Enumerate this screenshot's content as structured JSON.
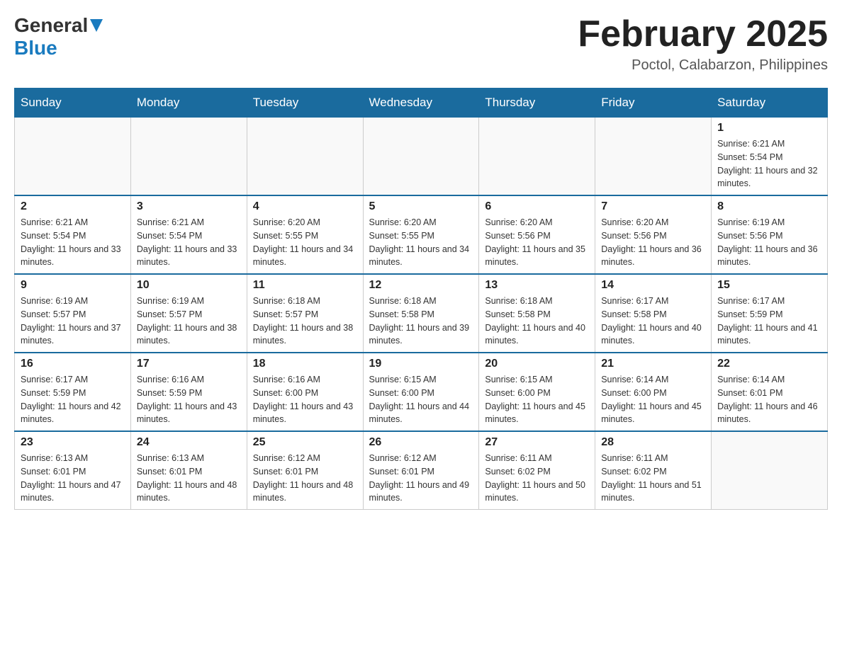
{
  "header": {
    "logo_general": "General",
    "logo_blue": "Blue",
    "month_title": "February 2025",
    "location": "Poctol, Calabarzon, Philippines"
  },
  "days_of_week": [
    "Sunday",
    "Monday",
    "Tuesday",
    "Wednesday",
    "Thursday",
    "Friday",
    "Saturday"
  ],
  "weeks": [
    {
      "days": [
        {
          "number": "",
          "sunrise": "",
          "sunset": "",
          "daylight": "",
          "empty": true
        },
        {
          "number": "",
          "sunrise": "",
          "sunset": "",
          "daylight": "",
          "empty": true
        },
        {
          "number": "",
          "sunrise": "",
          "sunset": "",
          "daylight": "",
          "empty": true
        },
        {
          "number": "",
          "sunrise": "",
          "sunset": "",
          "daylight": "",
          "empty": true
        },
        {
          "number": "",
          "sunrise": "",
          "sunset": "",
          "daylight": "",
          "empty": true
        },
        {
          "number": "",
          "sunrise": "",
          "sunset": "",
          "daylight": "",
          "empty": true
        },
        {
          "number": "1",
          "sunrise": "Sunrise: 6:21 AM",
          "sunset": "Sunset: 5:54 PM",
          "daylight": "Daylight: 11 hours and 32 minutes.",
          "empty": false
        }
      ]
    },
    {
      "days": [
        {
          "number": "2",
          "sunrise": "Sunrise: 6:21 AM",
          "sunset": "Sunset: 5:54 PM",
          "daylight": "Daylight: 11 hours and 33 minutes.",
          "empty": false
        },
        {
          "number": "3",
          "sunrise": "Sunrise: 6:21 AM",
          "sunset": "Sunset: 5:54 PM",
          "daylight": "Daylight: 11 hours and 33 minutes.",
          "empty": false
        },
        {
          "number": "4",
          "sunrise": "Sunrise: 6:20 AM",
          "sunset": "Sunset: 5:55 PM",
          "daylight": "Daylight: 11 hours and 34 minutes.",
          "empty": false
        },
        {
          "number": "5",
          "sunrise": "Sunrise: 6:20 AM",
          "sunset": "Sunset: 5:55 PM",
          "daylight": "Daylight: 11 hours and 34 minutes.",
          "empty": false
        },
        {
          "number": "6",
          "sunrise": "Sunrise: 6:20 AM",
          "sunset": "Sunset: 5:56 PM",
          "daylight": "Daylight: 11 hours and 35 minutes.",
          "empty": false
        },
        {
          "number": "7",
          "sunrise": "Sunrise: 6:20 AM",
          "sunset": "Sunset: 5:56 PM",
          "daylight": "Daylight: 11 hours and 36 minutes.",
          "empty": false
        },
        {
          "number": "8",
          "sunrise": "Sunrise: 6:19 AM",
          "sunset": "Sunset: 5:56 PM",
          "daylight": "Daylight: 11 hours and 36 minutes.",
          "empty": false
        }
      ]
    },
    {
      "days": [
        {
          "number": "9",
          "sunrise": "Sunrise: 6:19 AM",
          "sunset": "Sunset: 5:57 PM",
          "daylight": "Daylight: 11 hours and 37 minutes.",
          "empty": false
        },
        {
          "number": "10",
          "sunrise": "Sunrise: 6:19 AM",
          "sunset": "Sunset: 5:57 PM",
          "daylight": "Daylight: 11 hours and 38 minutes.",
          "empty": false
        },
        {
          "number": "11",
          "sunrise": "Sunrise: 6:18 AM",
          "sunset": "Sunset: 5:57 PM",
          "daylight": "Daylight: 11 hours and 38 minutes.",
          "empty": false
        },
        {
          "number": "12",
          "sunrise": "Sunrise: 6:18 AM",
          "sunset": "Sunset: 5:58 PM",
          "daylight": "Daylight: 11 hours and 39 minutes.",
          "empty": false
        },
        {
          "number": "13",
          "sunrise": "Sunrise: 6:18 AM",
          "sunset": "Sunset: 5:58 PM",
          "daylight": "Daylight: 11 hours and 40 minutes.",
          "empty": false
        },
        {
          "number": "14",
          "sunrise": "Sunrise: 6:17 AM",
          "sunset": "Sunset: 5:58 PM",
          "daylight": "Daylight: 11 hours and 40 minutes.",
          "empty": false
        },
        {
          "number": "15",
          "sunrise": "Sunrise: 6:17 AM",
          "sunset": "Sunset: 5:59 PM",
          "daylight": "Daylight: 11 hours and 41 minutes.",
          "empty": false
        }
      ]
    },
    {
      "days": [
        {
          "number": "16",
          "sunrise": "Sunrise: 6:17 AM",
          "sunset": "Sunset: 5:59 PM",
          "daylight": "Daylight: 11 hours and 42 minutes.",
          "empty": false
        },
        {
          "number": "17",
          "sunrise": "Sunrise: 6:16 AM",
          "sunset": "Sunset: 5:59 PM",
          "daylight": "Daylight: 11 hours and 43 minutes.",
          "empty": false
        },
        {
          "number": "18",
          "sunrise": "Sunrise: 6:16 AM",
          "sunset": "Sunset: 6:00 PM",
          "daylight": "Daylight: 11 hours and 43 minutes.",
          "empty": false
        },
        {
          "number": "19",
          "sunrise": "Sunrise: 6:15 AM",
          "sunset": "Sunset: 6:00 PM",
          "daylight": "Daylight: 11 hours and 44 minutes.",
          "empty": false
        },
        {
          "number": "20",
          "sunrise": "Sunrise: 6:15 AM",
          "sunset": "Sunset: 6:00 PM",
          "daylight": "Daylight: 11 hours and 45 minutes.",
          "empty": false
        },
        {
          "number": "21",
          "sunrise": "Sunrise: 6:14 AM",
          "sunset": "Sunset: 6:00 PM",
          "daylight": "Daylight: 11 hours and 45 minutes.",
          "empty": false
        },
        {
          "number": "22",
          "sunrise": "Sunrise: 6:14 AM",
          "sunset": "Sunset: 6:01 PM",
          "daylight": "Daylight: 11 hours and 46 minutes.",
          "empty": false
        }
      ]
    },
    {
      "days": [
        {
          "number": "23",
          "sunrise": "Sunrise: 6:13 AM",
          "sunset": "Sunset: 6:01 PM",
          "daylight": "Daylight: 11 hours and 47 minutes.",
          "empty": false
        },
        {
          "number": "24",
          "sunrise": "Sunrise: 6:13 AM",
          "sunset": "Sunset: 6:01 PM",
          "daylight": "Daylight: 11 hours and 48 minutes.",
          "empty": false
        },
        {
          "number": "25",
          "sunrise": "Sunrise: 6:12 AM",
          "sunset": "Sunset: 6:01 PM",
          "daylight": "Daylight: 11 hours and 48 minutes.",
          "empty": false
        },
        {
          "number": "26",
          "sunrise": "Sunrise: 6:12 AM",
          "sunset": "Sunset: 6:01 PM",
          "daylight": "Daylight: 11 hours and 49 minutes.",
          "empty": false
        },
        {
          "number": "27",
          "sunrise": "Sunrise: 6:11 AM",
          "sunset": "Sunset: 6:02 PM",
          "daylight": "Daylight: 11 hours and 50 minutes.",
          "empty": false
        },
        {
          "number": "28",
          "sunrise": "Sunrise: 6:11 AM",
          "sunset": "Sunset: 6:02 PM",
          "daylight": "Daylight: 11 hours and 51 minutes.",
          "empty": false
        },
        {
          "number": "",
          "sunrise": "",
          "sunset": "",
          "daylight": "",
          "empty": true
        }
      ]
    }
  ]
}
